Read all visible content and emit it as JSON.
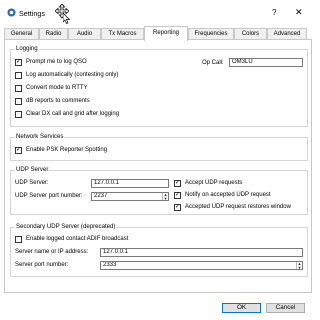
{
  "window": {
    "title": "Settings",
    "help": "?",
    "close": "✕"
  },
  "tabs": [
    {
      "label": "General"
    },
    {
      "label": "Radio"
    },
    {
      "label": "Audio"
    },
    {
      "label": "Tx Macros"
    },
    {
      "label": "Reporting"
    },
    {
      "label": "Frequencies"
    },
    {
      "label": "Colors"
    },
    {
      "label": "Advanced"
    }
  ],
  "active_tab": "Reporting",
  "logging": {
    "title": "Logging",
    "prompt": {
      "label": "Prompt me to log QSO",
      "checked": true
    },
    "auto": {
      "label": "Log automatically (contesting only)",
      "checked": false
    },
    "rtty": {
      "label": "Convert mode to RTTY",
      "checked": false
    },
    "db": {
      "label": "dB reports to comments",
      "checked": false
    },
    "clear": {
      "label": "Clear DX call and grid after logging",
      "checked": false
    },
    "op_call_label": "Op Call:",
    "op_call_value": "OM3LU"
  },
  "network": {
    "title": "Network Services",
    "psk": {
      "label": "Enable PSK Reporter Spotting",
      "checked": true
    }
  },
  "udp": {
    "title": "UDP Server",
    "server_label": "UDP Server:",
    "server_value": "127.0.0.1",
    "port_label": "UDP Server port number:",
    "port_value": "2237",
    "accept": {
      "label": "Accept UDP requests",
      "checked": true
    },
    "notify": {
      "label": "Notify on accepted UDP request",
      "checked": true
    },
    "restore": {
      "label": "Accepted UDP request restores window",
      "checked": true
    }
  },
  "secondary": {
    "title": "Secondary UDP Server (deprecated)",
    "adif": {
      "label": "Enable logged contact ADIF broadcast",
      "checked": false
    },
    "name_label": "Server name or IP address:",
    "name_value": "127.0.0.1",
    "port_label": "Server port number:",
    "port_value": "2333"
  },
  "buttons": {
    "ok": "OK",
    "cancel": "Cancel"
  },
  "check_glyph": "✓",
  "spin_up": "▲",
  "spin_down": "▼"
}
